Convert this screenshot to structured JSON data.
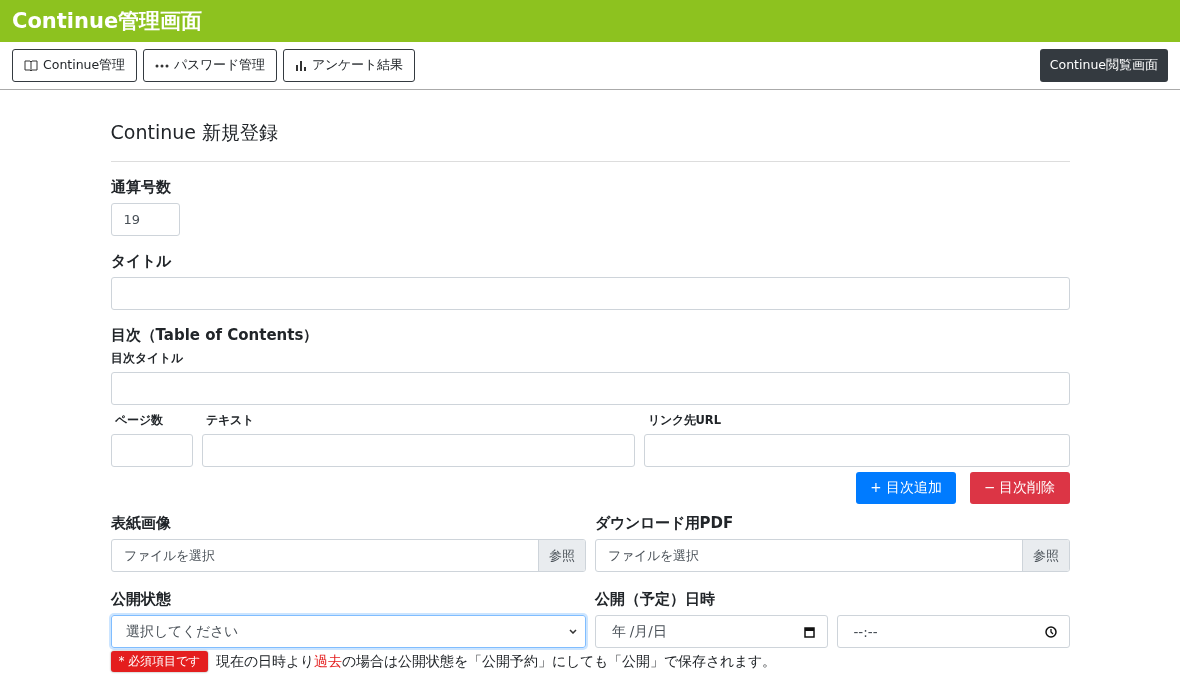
{
  "header": {
    "title": "Continue管理画面"
  },
  "nav": {
    "buttons": [
      {
        "kind": "book",
        "label": "Continue管理"
      },
      {
        "kind": "dots",
        "label": "パスワード管理"
      },
      {
        "kind": "bars",
        "label": "アンケート結果"
      }
    ],
    "view_button": "Continue閲覧画面"
  },
  "form": {
    "heading": "Continue 新規登録",
    "issue": {
      "label": "通算号数",
      "value": "19"
    },
    "title": {
      "label": "タイトル"
    },
    "toc": {
      "label": "目次（Table of Contents）",
      "title_label": "目次タイトル",
      "columns": [
        "ページ数",
        "テキスト",
        "リンク先URL"
      ],
      "buttons": [
        {
          "kind": "add",
          "label": "+ 目次追加"
        },
        {
          "kind": "remove",
          "label": "− 目次削除"
        }
      ]
    },
    "cover": {
      "label": "表紙画像",
      "placeholder": "ファイルを選択",
      "browse": "参照"
    },
    "pdf": {
      "label": "ダウンロード用PDF",
      "placeholder": "ファイルを選択",
      "browse": "参照"
    },
    "status": {
      "label": "公開状態",
      "value": "選択してください",
      "tooltip": "* 必須項目です"
    },
    "publish": {
      "label": "公開（予定）日時",
      "date": "年 /月/日",
      "time": "--:--"
    },
    "note": [
      {
        "kind": "plain",
        "text": "現在の日時より"
      },
      {
        "kind": "warn",
        "text": "過去"
      },
      {
        "kind": "plain",
        "text": "の場合は公開状態を「公開予約」にしても「公開」で保存されます。"
      }
    ]
  }
}
